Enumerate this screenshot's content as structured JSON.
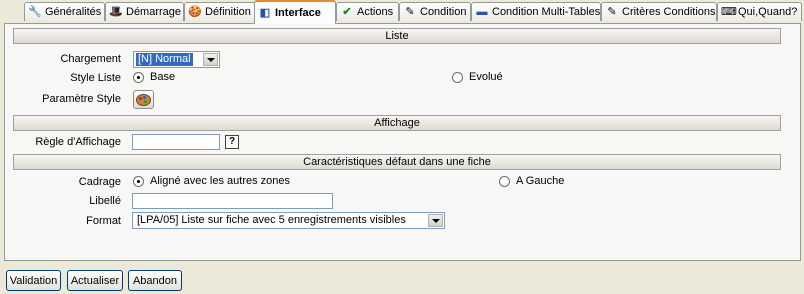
{
  "tabs": [
    {
      "label": "Généralités",
      "icon": "wrench-icon"
    },
    {
      "label": "Démarrage",
      "icon": "hat-icon"
    },
    {
      "label": "Définition",
      "icon": "cookie-icon"
    },
    {
      "label": "Interface",
      "icon": "interface-icon"
    },
    {
      "label": "Actions",
      "icon": "check-icon"
    },
    {
      "label": "Condition",
      "icon": "edit-icon"
    },
    {
      "label": "Condition Multi-Tables",
      "icon": "table-icon"
    },
    {
      "label": "Critères Conditions",
      "icon": "edit-icon"
    },
    {
      "label": "Qui,Quand?",
      "icon": "keyboard-icon"
    }
  ],
  "active_tab": "Interface",
  "sections": {
    "liste": "Liste",
    "affichage": "Affichage",
    "caracteristiques": "Caractéristiques défaut dans une fiche"
  },
  "liste": {
    "chargement_label": "Chargement",
    "chargement_value": "[N] Normal",
    "style_liste_label": "Style Liste",
    "style_options": [
      {
        "label": "Base",
        "selected": true
      },
      {
        "label": "Evolué",
        "selected": false
      }
    ],
    "parametre_style_label": "Paramètre Style",
    "parametre_style_icon": "palette-icon"
  },
  "affichage": {
    "regle_label": "Règle d'Affichage",
    "regle_value": "",
    "help_label": "?"
  },
  "fiche": {
    "cadrage_label": "Cadrage",
    "cadrage_options": [
      {
        "label": "Aligné avec les autres zones",
        "selected": true
      },
      {
        "label": "A Gauche",
        "selected": false
      }
    ],
    "libelle_label": "Libellé",
    "libelle_value": "",
    "format_label": "Format",
    "format_value": "[LPA/05] Liste sur fiche avec 5 enregistrements visibles"
  },
  "buttons": {
    "validation": "Validation",
    "actualiser": "Actualiser",
    "abandon": "Abandon"
  },
  "colors": {
    "selection": "#316ac5",
    "active_tab_accent": "#e68b2c",
    "background": "#ece9d8"
  }
}
